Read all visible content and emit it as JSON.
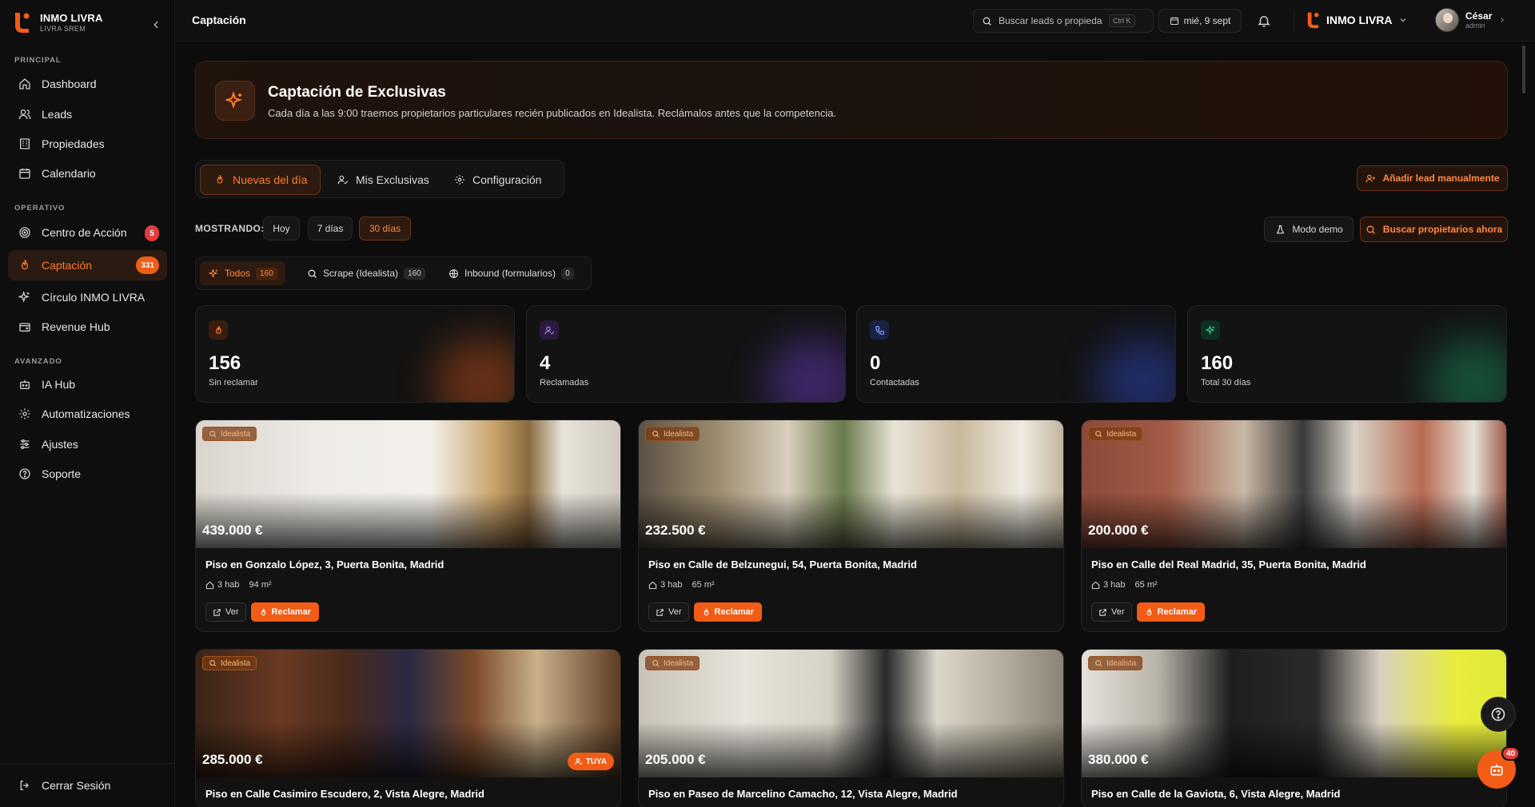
{
  "brand": {
    "name": "INMO LIVRA",
    "sub": "LIVRA SREM",
    "accent": "#f25c16"
  },
  "sidebar": {
    "sections": [
      {
        "label": "PRINCIPAL"
      },
      {
        "label": "OPERATIVO"
      },
      {
        "label": "AVANZADO"
      }
    ],
    "items": [
      {
        "label": "Dashboard",
        "icon": "home-icon"
      },
      {
        "label": "Leads",
        "icon": "users-icon"
      },
      {
        "label": "Propiedades",
        "icon": "building-icon"
      },
      {
        "label": "Calendario",
        "icon": "calendar-icon"
      },
      {
        "label": "Centro de Acción",
        "icon": "target-icon",
        "badge": "5"
      },
      {
        "label": "Captación",
        "icon": "flame-icon",
        "badge": "331",
        "active": true
      },
      {
        "label": "Círculo INMO LIVRA",
        "icon": "sparkles-icon"
      },
      {
        "label": "Revenue Hub",
        "icon": "wallet-icon"
      },
      {
        "label": "IA Hub",
        "icon": "bot-icon"
      },
      {
        "label": "Automatizaciones",
        "icon": "cog-icon"
      },
      {
        "label": "Ajustes",
        "icon": "sliders-icon"
      },
      {
        "label": "Soporte",
        "icon": "help-icon"
      }
    ],
    "logout": "Cerrar Sesión"
  },
  "header": {
    "title": "Captación",
    "search_placeholder": "Buscar leads o propiedades",
    "shortcut": "Ctrl K",
    "date": "mié, 9 sept",
    "org": "INMO LIVRA",
    "user_name": "César",
    "user_role": "admin"
  },
  "hero": {
    "title": "Captación de Exclusivas",
    "description": "Cada día a las 9:00 traemos propietarios particulares recién publicados en Idealista. Reclámalos antes que la competencia."
  },
  "tabs": [
    {
      "label": "Nuevas del día",
      "icon": "flame-icon",
      "active": true
    },
    {
      "label": "Mis Exclusivas",
      "icon": "user-check-icon"
    },
    {
      "label": "Configuración",
      "icon": "gear-icon"
    }
  ],
  "actions": {
    "add_lead": "Añadir lead manualmente",
    "demo_mode": "Modo demo",
    "search_owners": "Buscar propietarios ahora"
  },
  "range_filter": {
    "label": "MOSTRANDO:",
    "options": [
      "Hoy",
      "7 días",
      "30 días"
    ],
    "selected": "30 días"
  },
  "source_tabs": [
    {
      "label": "Todos",
      "count": "160",
      "icon": "sparkles-icon",
      "active": true
    },
    {
      "label": "Scrape (Idealista)",
      "count": "160",
      "icon": "search-icon"
    },
    {
      "label": "Inbound (formularios)",
      "count": "0",
      "icon": "globe-icon"
    }
  ],
  "stats": [
    {
      "value": "156",
      "label": "Sin reclamar",
      "icon": "flame-icon",
      "color": "#ff7a2f"
    },
    {
      "value": "4",
      "label": "Reclamadas",
      "icon": "user-check-icon",
      "color": "#b57cff"
    },
    {
      "value": "0",
      "label": "Contactadas",
      "icon": "phone-icon",
      "color": "#6a8cff"
    },
    {
      "value": "160",
      "label": "Total 30 días",
      "icon": "sparkles-icon",
      "color": "#2fd38a"
    }
  ],
  "listings": [
    {
      "source": "Idealista",
      "price": "439.000 €",
      "address": "Piso en Gonzalo López, 3, Puerta Bonita, Madrid",
      "rooms": "3 hab",
      "area": "94 m²"
    },
    {
      "source": "Idealista",
      "price": "232.500 €",
      "address": "Piso en Calle de Belzunegui, 54, Puerta Bonita, Madrid",
      "rooms": "3 hab",
      "area": "65 m²"
    },
    {
      "source": "Idealista",
      "price": "200.000 €",
      "address": "Piso en Calle del Real Madrid, 35, Puerta Bonita, Madrid",
      "rooms": "3 hab",
      "area": "65 m²"
    },
    {
      "source": "Idealista",
      "price": "285.000 €",
      "address": "Piso en Calle Casimiro Escudero, 2, Vista Alegre, Madrid",
      "tag": "TUYA"
    },
    {
      "source": "Idealista",
      "price": "205.000 €",
      "address": "Piso en Paseo de Marcelino Camacho, 12, Vista Alegre, Madrid"
    },
    {
      "source": "Idealista",
      "price": "380.000 €",
      "address": "Piso en Calle de la Gaviota, 6, Vista Alegre, Madrid"
    }
  ],
  "card_actions": {
    "view": "Ver",
    "claim": "Reclamar"
  },
  "assistant_badge": "40"
}
